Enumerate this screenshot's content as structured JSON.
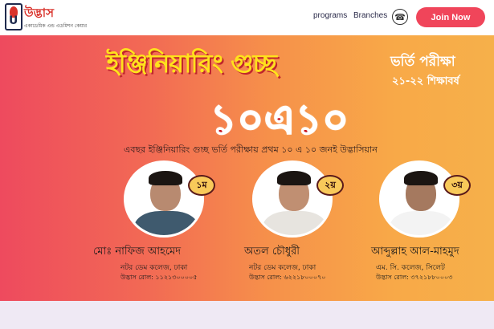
{
  "header": {
    "logo": {
      "title": "উদ্ভাস",
      "subtitle": "একাডেমিক এন্ড এডমিশন কেয়ার",
      "mark_letter": "U"
    },
    "nav": [
      "programs",
      "Branches"
    ],
    "phone_icon": "☎",
    "join_label": "Join Now",
    "accent_color": "#f0455a"
  },
  "banner": {
    "headline": "ইঞ্জিনিয়ারিং গুচ্ছ",
    "exam_title": "ভর্তি পরীক্ষা",
    "exam_year": "২১-২২ শিক্ষাবর্ষ",
    "big_number": "১০এ১০",
    "tagline": "এবছর ইঞ্জিনিয়ারিং গুচ্ছ ভর্তি পরীক্ষায় প্রথম ১০ এ ১০ জনই উদ্ভাসিয়ান",
    "students": [
      {
        "rank": "১ম",
        "name": "মোঃ নাফিজ আহমেদ",
        "college": "নটর ডেম কলেজ, ঢাকা",
        "roll": "উদ্ভাস রোল: ১১২১৩০০০০৫"
      },
      {
        "rank": "২য়",
        "name": "অতল চৌধুরী",
        "college": "নটর ডেম কলেজ, ঢাকা",
        "roll": "উদ্ভাস রোল: ৬২২১৮০০০৭০"
      },
      {
        "rank": "৩য়",
        "name": "আব্দুল্লাহ আল-মাহমুদ",
        "college": "এম. সি. কলেজ, সিলেট",
        "roll": "উদ্ভাস রোল: ৩৭২১৮৮০০০৩"
      }
    ],
    "slides_total": 5,
    "slide_active": 4
  }
}
